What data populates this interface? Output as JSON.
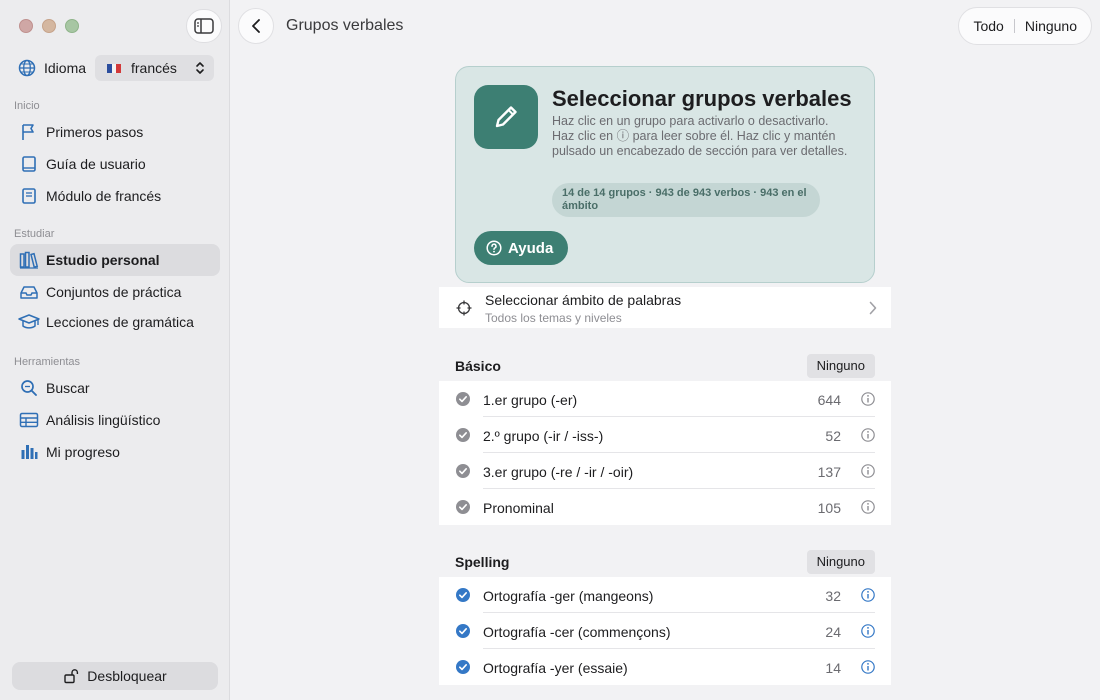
{
  "sidebar": {
    "language_label": "Idioma",
    "language_value": "francés",
    "sections": [
      {
        "title": "Inicio",
        "items": [
          {
            "label": "Primeros pasos",
            "icon": "flag-icon"
          },
          {
            "label": "Guía de usuario",
            "icon": "book-icon"
          },
          {
            "label": "Módulo de francés",
            "icon": "module-book-icon"
          }
        ]
      },
      {
        "title": "Estudiar",
        "items": [
          {
            "label": "Estudio personal",
            "icon": "library-icon",
            "active": true
          },
          {
            "label": "Conjuntos de práctica",
            "icon": "tray-icon"
          },
          {
            "label": "Lecciones de gramática",
            "icon": "graduation-cap-icon"
          }
        ]
      },
      {
        "title": "Herramientas",
        "items": [
          {
            "label": "Buscar",
            "icon": "search-icon"
          },
          {
            "label": "Análisis lingüístico",
            "icon": "table-icon"
          },
          {
            "label": "Mi progreso",
            "icon": "bar-chart-icon"
          }
        ]
      }
    ],
    "unlock_label": "Desbloquear"
  },
  "header": {
    "title": "Grupos verbales",
    "all_label": "Todo",
    "none_label": "Ninguno"
  },
  "hero": {
    "title": "Seleccionar grupos verbales",
    "description": "Haz clic en un grupo para activarlo o desactivarlo. Haz clic en ⓘ para leer sobre él. Haz clic y mantén pulsado un encabezado de sección para ver detalles.",
    "badge": "14 de 14 grupos · 943 de 943 verbos · 943 en el ámbito",
    "help_label": "Ayuda"
  },
  "scope": {
    "title": "Seleccionar ámbito de palabras",
    "subtitle": "Todos los temas y niveles"
  },
  "groups": [
    {
      "title": "Básico",
      "none_label": "Ninguno",
      "rows": [
        {
          "label": "1.er grupo (-er)",
          "count": "644"
        },
        {
          "label": "2.º grupo (-ir / -iss-)",
          "count": "52"
        },
        {
          "label": "3.er grupo (-re / -ir / -oir)",
          "count": "137"
        },
        {
          "label": "Pronominal",
          "count": "105"
        }
      ]
    },
    {
      "title": "Spelling",
      "none_label": "Ninguno",
      "rows": [
        {
          "label": "Ortografía -ger (mangeons)",
          "count": "32"
        },
        {
          "label": "Ortografía -cer (commençons)",
          "count": "24"
        },
        {
          "label": "Ortografía -yer (essaie)",
          "count": "14"
        }
      ]
    }
  ],
  "colors": {
    "accent": "#3d7f73",
    "check_gray": "#8e8e93",
    "check_blue": "#3478c6"
  }
}
